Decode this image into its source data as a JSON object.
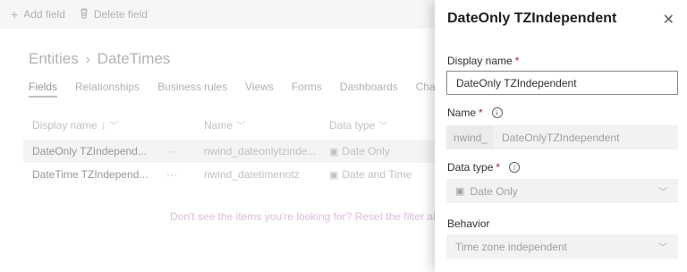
{
  "commandbar": {
    "add_field": "Add field",
    "delete_field": "Delete field"
  },
  "breadcrumb": {
    "root": "Entities",
    "current": "DateTimes"
  },
  "tabs": [
    "Fields",
    "Relationships",
    "Business rules",
    "Views",
    "Forms",
    "Dashboards",
    "Charts"
  ],
  "table": {
    "columns": {
      "display_name": "Display name",
      "name": "Name",
      "data_type": "Data type"
    },
    "rows": [
      {
        "display_name": "DateOnly TZIndepend...",
        "more": "···",
        "name": "nwind_dateonlytzinde...",
        "data_type": "Date Only"
      },
      {
        "display_name": "DateTime TZIndepend...",
        "more": "···",
        "name": "nwind_datetimenotz",
        "data_type": "Date and Time"
      }
    ]
  },
  "empty_message": "Don't see the items you're looking for? Reset the filter ab",
  "panel": {
    "title": "DateOnly TZIndependent",
    "display_name_label": "Display name",
    "display_name_value": "DateOnly TZIndependent",
    "name_label": "Name",
    "name_prefix": "nwind_",
    "name_value": "DateOnlyTZIndependent",
    "data_type_label": "Data type",
    "data_type_value": "Date Only",
    "behavior_label": "Behavior",
    "behavior_value": "Time zone independent",
    "required_mark": "*"
  }
}
